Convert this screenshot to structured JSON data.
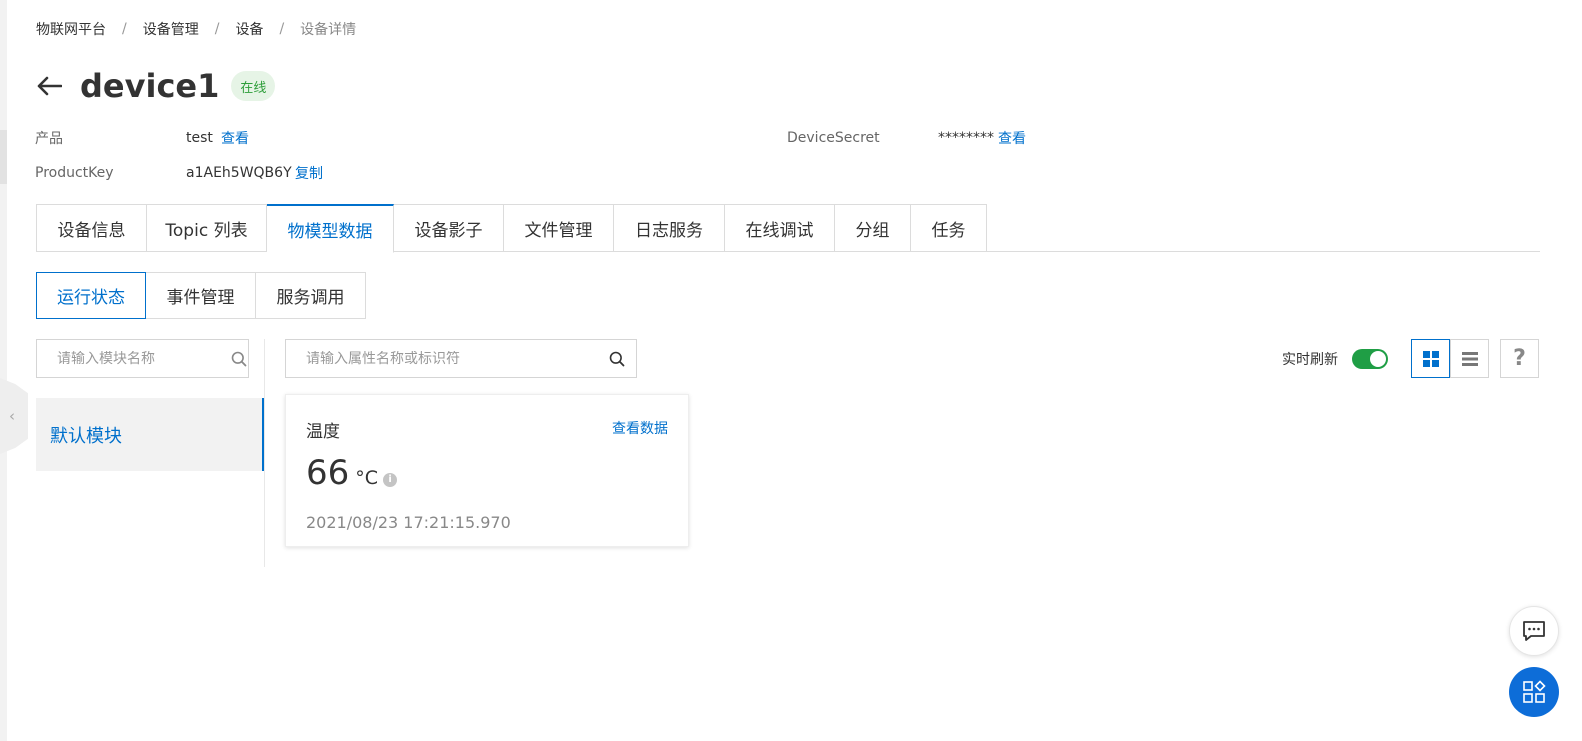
{
  "breadcrumb": {
    "items": [
      "物联网平台",
      "设备管理",
      "设备"
    ],
    "separator": "/",
    "current": "设备详情"
  },
  "header": {
    "title": "device1",
    "status": "在线"
  },
  "meta": {
    "product_label": "产品",
    "product_value": "test",
    "product_link": "查看",
    "productkey_label": "ProductKey",
    "productkey_value": "a1AEh5WQB6Y",
    "productkey_link": "复制",
    "secret_label": "DeviceSecret",
    "secret_value": "********",
    "secret_link": "查看"
  },
  "tabs": [
    {
      "label": "设备信息"
    },
    {
      "label": "Topic 列表"
    },
    {
      "label": "物模型数据",
      "active": true
    },
    {
      "label": "设备影子"
    },
    {
      "label": "文件管理"
    },
    {
      "label": "日志服务"
    },
    {
      "label": "在线调试"
    },
    {
      "label": "分组"
    },
    {
      "label": "任务"
    }
  ],
  "subtabs": [
    {
      "label": "运行状态",
      "active": true
    },
    {
      "label": "事件管理"
    },
    {
      "label": "服务调用"
    }
  ],
  "module_search": {
    "placeholder": "请输入模块名称"
  },
  "property_search": {
    "placeholder": "请输入属性名称或标识符"
  },
  "modules": [
    {
      "label": "默认模块",
      "active": true
    }
  ],
  "property": {
    "name": "温度",
    "link": "查看数据",
    "value": "66",
    "unit": "°C",
    "time": "2021/08/23 17:21:15.970"
  },
  "toolbar": {
    "refresh_label": "实时刷新",
    "refresh_on": true,
    "view_mode": "grid",
    "help_label": "?"
  },
  "colors": {
    "accent": "#0070cc",
    "online_green": "#2e9e3a",
    "toggle_green": "#1f9e45",
    "float_blue": "#0d6dd8"
  },
  "icons": {
    "back": "arrow-left-icon",
    "search": "search-icon",
    "info": "info-icon",
    "grid": "grid-view-icon",
    "list": "list-view-icon",
    "chat": "chat-icon",
    "apps": "apps-icon",
    "collapse": "chevron-left-icon"
  }
}
